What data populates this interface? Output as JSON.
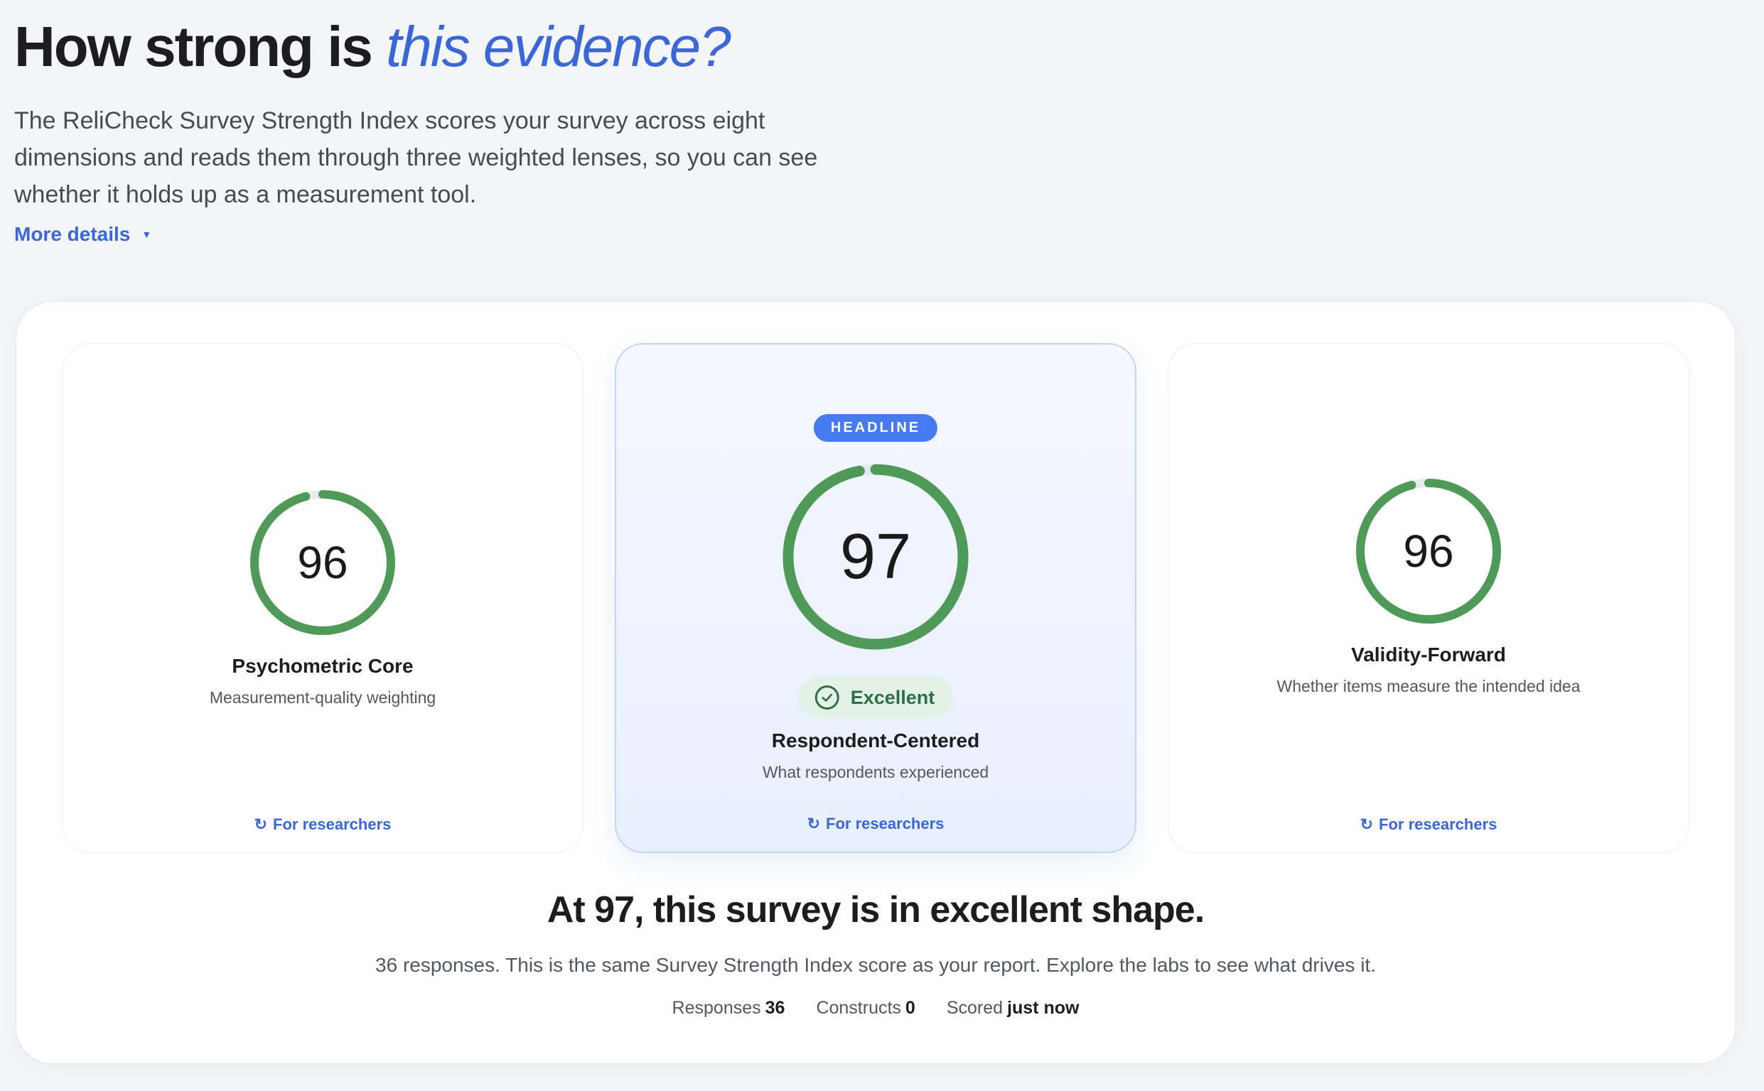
{
  "hero": {
    "title_plain": "How strong is ",
    "title_accent": "this evidence?",
    "description": "The ReliCheck Survey Strength Index scores your survey across eight dimensions and reads them through three weighted lenses, so you can see whether it holds up as a measurement tool.",
    "more_details": "More details"
  },
  "cards": [
    {
      "score": 96,
      "title": "Psychometric Core",
      "subtitle": "Measurement-quality weighting",
      "link": "For researchers"
    },
    {
      "badge": "HEADLINE",
      "score": 97,
      "status": "Excellent",
      "title": "Respondent-Centered",
      "subtitle": "What respondents experienced",
      "link": "For researchers"
    },
    {
      "score": 96,
      "title": "Validity-Forward",
      "subtitle": "Whether items measure the intended idea",
      "link": "For researchers"
    }
  ],
  "summary": {
    "headline": "At 97, this survey is in excellent shape.",
    "detail": "36 responses. This is the same Survey Strength Index score as your report. Explore the labs to see what drives it.",
    "stats": [
      {
        "label": "Responses",
        "value": "36"
      },
      {
        "label": "Constructs",
        "value": "0"
      },
      {
        "label": "Scored",
        "value": "just now"
      }
    ]
  },
  "colors": {
    "accent": "#3a66d8",
    "ring": "#4f9a59",
    "badge": "#4779f0",
    "excellent": "#2f6f45"
  }
}
